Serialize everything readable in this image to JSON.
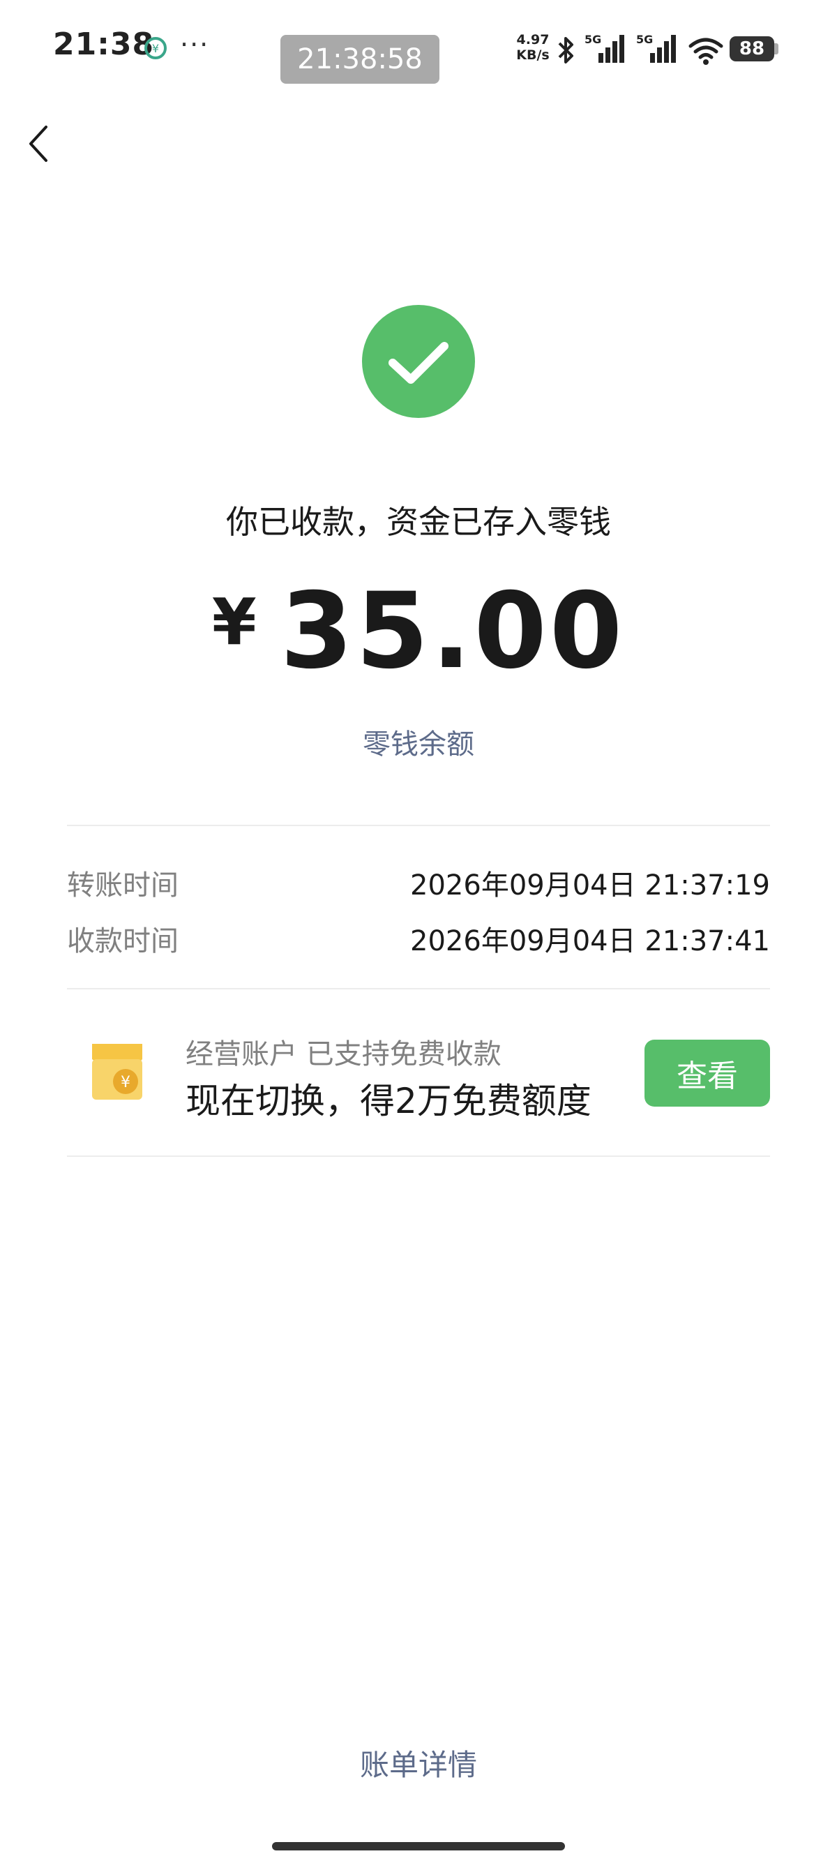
{
  "status_bar": {
    "time": "21:38",
    "dots": "···",
    "screen_clock": "21:38:58",
    "net_speed_value": "4.97",
    "net_speed_unit": "KB/s",
    "sim1_label": "5G",
    "sim2_label": "5G",
    "battery": "88"
  },
  "result": {
    "message": "你已收款，资金已存入零钱",
    "currency_symbol": "¥",
    "amount": "35.00",
    "balance_link": "零钱余额"
  },
  "details": [
    {
      "label": "转账时间",
      "value": "2026年09月04日 21:37:19"
    },
    {
      "label": "收款时间",
      "value": "2026年09月04日 21:37:41"
    }
  ],
  "promo": {
    "subtitle": "经营账户 已支持免费收款",
    "title": "现在切换，得2万免费额度",
    "button_label": "查看"
  },
  "footer": {
    "bill_detail_link": "账单详情"
  },
  "colors": {
    "success_green": "#57be6a",
    "link_blue_gray": "#5d6b8a",
    "shop_yellow": "#f6c544"
  }
}
